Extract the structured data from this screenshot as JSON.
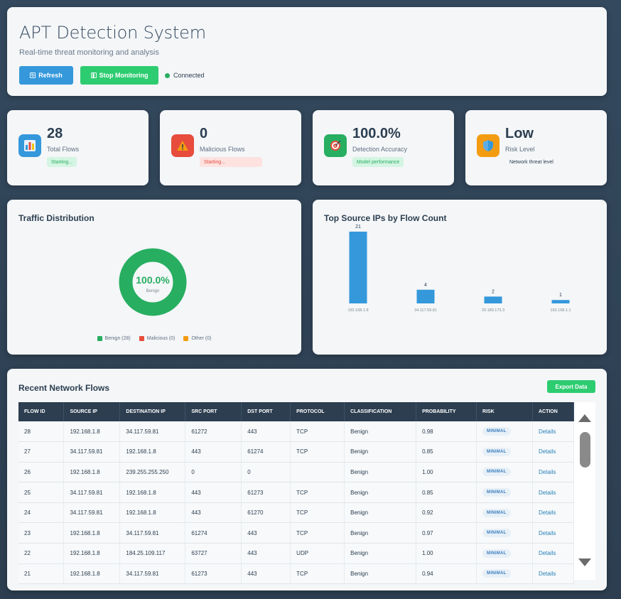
{
  "header": {
    "title": "APT Detection System",
    "subtitle": "Real-time threat monitoring and analysis",
    "refresh_label": "Refresh",
    "stop_label": "Stop Monitoring",
    "status_text": "Connected"
  },
  "stats": {
    "flows": {
      "value": "28",
      "label": "Total Flows",
      "badge": "Starting...",
      "icon": "bar-chart-icon"
    },
    "malicious": {
      "value": "0",
      "label": "Malicious Flows",
      "badge": "Starting...",
      "icon": "warning-icon"
    },
    "accuracy": {
      "value": "100.0%",
      "label": "Detection Accuracy",
      "badge": "Model performance",
      "icon": "target-icon"
    },
    "risk": {
      "value": "Low",
      "label": "Risk Level",
      "badge": "Network threat level",
      "icon": "shield-icon"
    }
  },
  "traffic": {
    "title": "Traffic Distribution",
    "center_value": "100.0%",
    "center_label": "Benign",
    "legend": [
      "Benign (28)",
      "Malicious (0)",
      "Other (0)"
    ],
    "colors": {
      "benign": "#27ae60",
      "malicious": "#e74c3c",
      "other": "#f39c12"
    }
  },
  "chart_data": {
    "type": "bar",
    "title": "Top Source IPs by Flow Count",
    "categories": [
      "192.168.1.8",
      "34.117.59.81",
      "20.189.173.3",
      "192.168.1.1"
    ],
    "values": [
      21,
      4,
      2,
      1
    ],
    "ylim": [
      0,
      21
    ],
    "grid": false,
    "color": "#3498db"
  },
  "flows": {
    "title": "Recent Network Flows",
    "export_label": "Export Data",
    "columns": [
      "FLOW ID",
      "SOURCE IP",
      "DESTINATION IP",
      "SRC PORT",
      "DST PORT",
      "PROTOCOL",
      "CLASSIFICATION",
      "PROBABILITY",
      "RISK",
      "ACTION"
    ],
    "rows": [
      [
        "28",
        "192.168.1.8",
        "34.117.59.81",
        "61272",
        "443",
        "TCP",
        "Benign",
        "0.98",
        "MINIMAL",
        "Details"
      ],
      [
        "27",
        "34.117.59.81",
        "192.168.1.8",
        "443",
        "61274",
        "TCP",
        "Benign",
        "0.85",
        "MINIMAL",
        "Details"
      ],
      [
        "26",
        "192.168.1.8",
        "239.255.255.250",
        "0",
        "0",
        "",
        "Benign",
        "1.00",
        "MINIMAL",
        "Details"
      ],
      [
        "25",
        "34.117.59.81",
        "192.168.1.8",
        "443",
        "61273",
        "TCP",
        "Benign",
        "0.85",
        "MINIMAL",
        "Details"
      ],
      [
        "24",
        "34.117.59.81",
        "192.168.1.8",
        "443",
        "61270",
        "TCP",
        "Benign",
        "0.92",
        "MINIMAL",
        "Details"
      ],
      [
        "23",
        "192.168.1.8",
        "34.117.59.81",
        "61274",
        "443",
        "TCP",
        "Benign",
        "0.97",
        "MINIMAL",
        "Details"
      ],
      [
        "22",
        "192.168.1.8",
        "184.25.109.117",
        "63727",
        "443",
        "UDP",
        "Benign",
        "1.00",
        "MINIMAL",
        "Details"
      ],
      [
        "21",
        "192.168.1.8",
        "34.117.59.81",
        "61273",
        "443",
        "TCP",
        "Benign",
        "0.94",
        "MINIMAL",
        "Details"
      ]
    ]
  }
}
